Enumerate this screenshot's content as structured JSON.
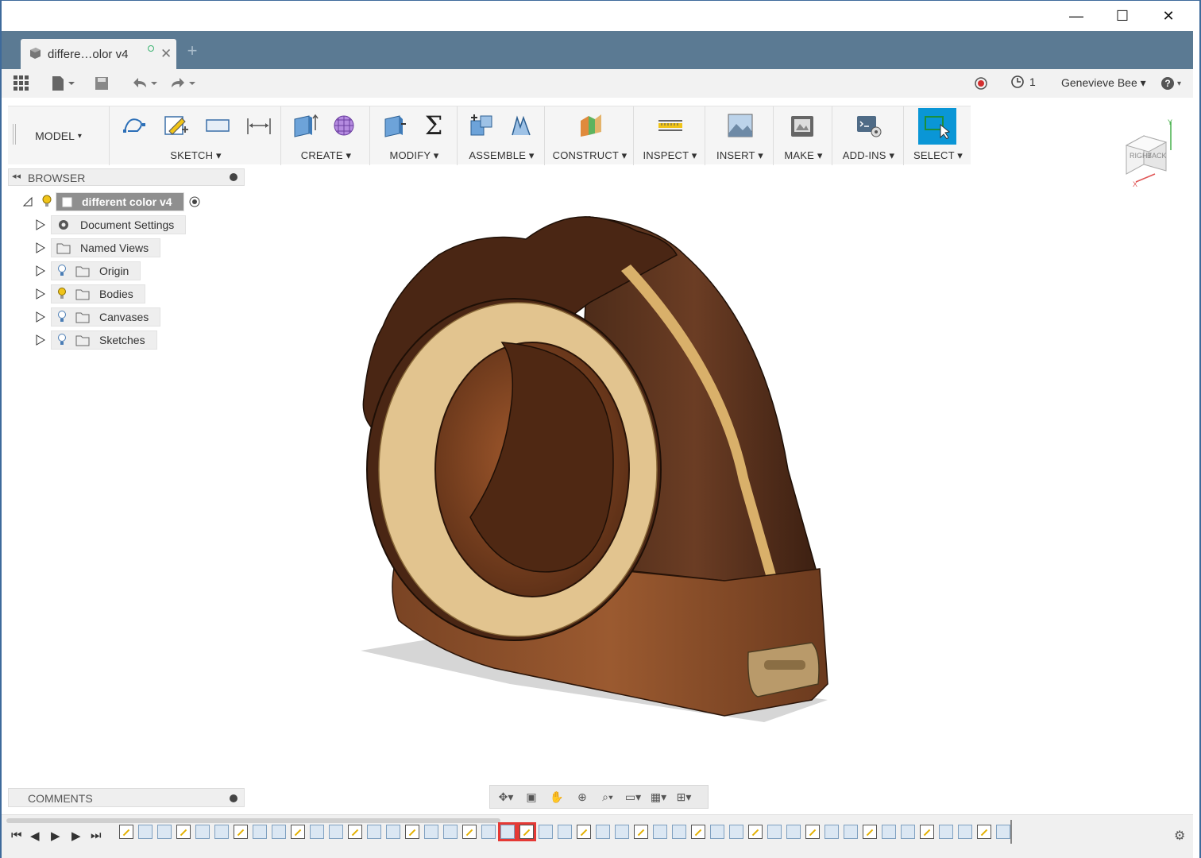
{
  "window": {
    "minimize": "—",
    "maximize": "☐",
    "close": "✕"
  },
  "tab": {
    "title": "differe…olor v4",
    "new_tab": "+"
  },
  "quickbar": {
    "jobs_count": "1",
    "user": "Genevieve Bee",
    "help": "?"
  },
  "ribbon": {
    "workspace": "MODEL",
    "groups": {
      "sketch": "SKETCH",
      "create": "CREATE",
      "modify": "MODIFY",
      "assemble": "ASSEMBLE",
      "construct": "CONSTRUCT",
      "inspect": "INSPECT",
      "insert": "INSERT",
      "make": "MAKE",
      "addins": "ADD-INS",
      "select": "SELECT"
    }
  },
  "browser": {
    "title": "BROWSER",
    "root": "different color v4",
    "items": [
      {
        "label": "Document Settings",
        "icon": "gear-icon"
      },
      {
        "label": "Named Views",
        "icon": "folder-icon"
      },
      {
        "label": "Origin",
        "icon": "folder-icon"
      },
      {
        "label": "Bodies",
        "icon": "folder-icon"
      },
      {
        "label": "Canvases",
        "icon": "folder-icon"
      },
      {
        "label": "Sketches",
        "icon": "folder-icon"
      }
    ]
  },
  "comments": {
    "title": "COMMENTS"
  },
  "viewcube": {
    "right": "RIGHT",
    "back": "BACK",
    "x": "X",
    "y": "Y"
  },
  "colors": {
    "accent": "#0a96d6",
    "tabbar": "#5b7a93",
    "highlight": "#e53935"
  }
}
